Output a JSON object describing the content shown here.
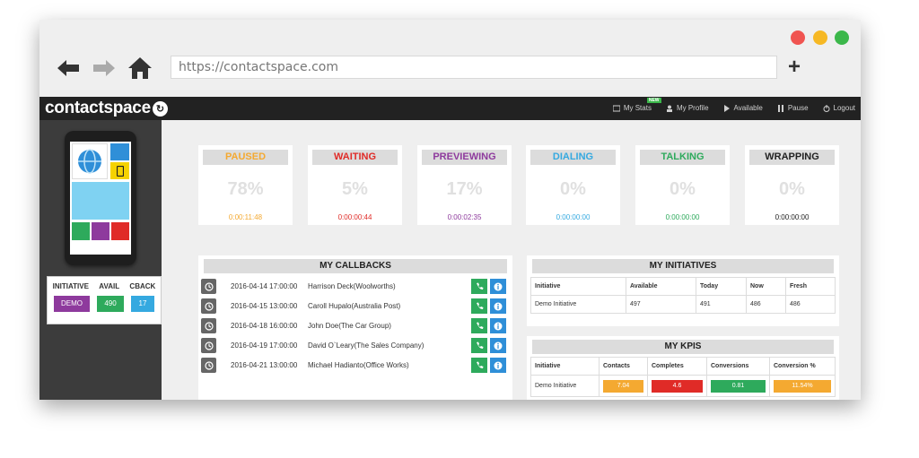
{
  "browser": {
    "url": "https://contactspace.com"
  },
  "app": {
    "logo_text": "contactspace",
    "logo_mark": "↻",
    "nav": [
      {
        "label": "My Stats",
        "badge": "NEW",
        "icon": "bar-chart-icon"
      },
      {
        "label": "My Profile",
        "icon": "user-icon"
      },
      {
        "label": "Available",
        "icon": "play-icon"
      },
      {
        "label": "Pause",
        "icon": "pause-icon"
      },
      {
        "label": "Logout",
        "icon": "power-icon"
      }
    ]
  },
  "agent": {
    "headers": [
      "INITIATIVE",
      "AVAIL",
      "CBACK"
    ],
    "initiative": "DEMO",
    "avail": "490",
    "cback": "17",
    "colors": {
      "initiative": "#8e3a9d",
      "avail": "#2eaa5c",
      "cback": "#35a9e0"
    }
  },
  "statuses": [
    {
      "label": "PAUSED",
      "percent": "78%",
      "time": "0:00:11:48",
      "color": "#f4a931"
    },
    {
      "label": "WAITING",
      "percent": "5%",
      "time": "0:00:00:44",
      "color": "#e02b27"
    },
    {
      "label": "PREVIEWING",
      "percent": "17%",
      "time": "0:00:02:35",
      "color": "#8e3a9d"
    },
    {
      "label": "DIALING",
      "percent": "0%",
      "time": "0:00:00:00",
      "color": "#35a9e0"
    },
    {
      "label": "TALKING",
      "percent": "0%",
      "time": "0:00:00:00",
      "color": "#2eaa5c"
    },
    {
      "label": "WRAPPING",
      "percent": "0%",
      "time": "0:00:00:00",
      "color": "#222222"
    }
  ],
  "callbacks": {
    "title": "MY CALLBACKS",
    "rows": [
      {
        "date": "2016-04-14 17:00:00",
        "contact": "Harrison Deck(Woolworths)"
      },
      {
        "date": "2016-04-15 13:00:00",
        "contact": "Caroll Hupalo(Australia Post)"
      },
      {
        "date": "2016-04-18 16:00:00",
        "contact": "John Doe(The Car Group)"
      },
      {
        "date": "2016-04-19 17:00:00",
        "contact": "David O`Leary(The Sales Company)"
      },
      {
        "date": "2016-04-21 13:00:00",
        "contact": "Michael Hadianto(Office Works)"
      }
    ]
  },
  "initiatives": {
    "title": "MY INITIATIVES",
    "headers": [
      "Initiative",
      "Available",
      "Today",
      "Now",
      "Fresh"
    ],
    "rows": [
      [
        "Demo Initiative",
        "497",
        "491",
        "486",
        "486"
      ]
    ]
  },
  "kpis": {
    "title": "MY KPIS",
    "headers": [
      "Initiative",
      "Contacts",
      "Completes",
      "Conversions",
      "Conversion %"
    ],
    "row": {
      "initiative": "Demo Initiative",
      "contacts": "7.04",
      "completes": "4.6",
      "conversions": "0.81",
      "conversion_pct": "11.54%"
    },
    "colors": {
      "contacts": "#f4a931",
      "completes": "#e02b27",
      "conversions": "#2eaa5c",
      "conversion_pct": "#f4a931"
    }
  },
  "phone_tiles": {
    "colors": [
      "#2f8fd8",
      "#f5d200",
      "#7fd2f2",
      "#2eaa5c",
      "#8e3a9d",
      "#e02b27"
    ]
  }
}
